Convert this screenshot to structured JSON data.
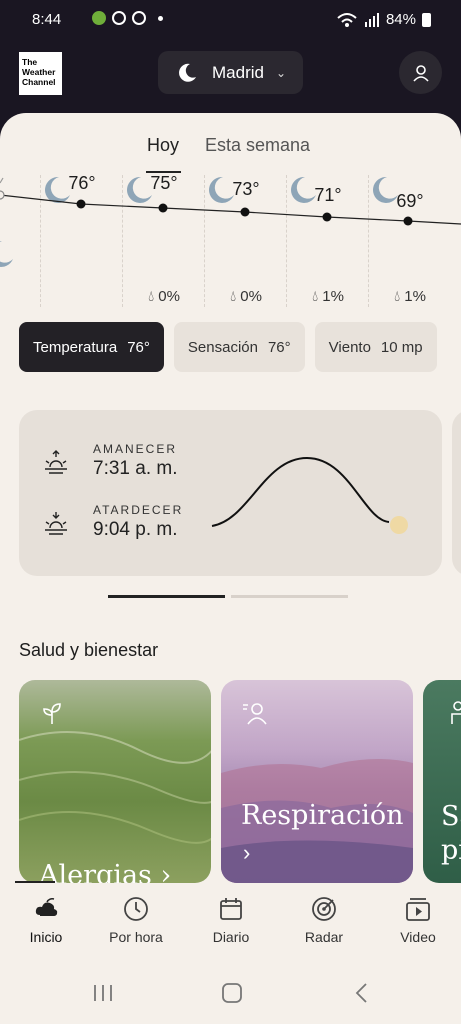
{
  "status_bar": {
    "time": "8:44",
    "battery": "84%"
  },
  "header": {
    "logo_lines": [
      "The",
      "Weather",
      "Channel"
    ],
    "city": "Madrid"
  },
  "tabs": [
    "Hoy",
    "Esta semana"
  ],
  "hourly": [
    {
      "temp": "76°",
      "precip": ""
    },
    {
      "temp": "75°",
      "precip": "0%"
    },
    {
      "temp": "73°",
      "precip": "0%"
    },
    {
      "temp": "71°",
      "precip": "1%"
    },
    {
      "temp": "69°",
      "precip": "1%"
    }
  ],
  "chips": [
    {
      "label": "Temperatura",
      "value": "76°"
    },
    {
      "label": "Sensación",
      "value": "76°"
    },
    {
      "label": "Viento",
      "value": "10 mp"
    }
  ],
  "sun": {
    "sunrise_label": "AMANECER",
    "sunrise_time": "7:31 a. m.",
    "sunset_label": "ATARDECER",
    "sunset_time": "9:04 p. m."
  },
  "health": {
    "title": "Salud y bienestar",
    "cards": [
      "Alergias ›",
      "Respiración",
      "Sa pi"
    ]
  },
  "nav": [
    "Inicio",
    "Por hora",
    "Diario",
    "Radar",
    "Video"
  ],
  "colors": {
    "dark": "#1a1622",
    "sheet": "#f5f0ea",
    "accent": "#232126",
    "sun": "#efd9a4"
  }
}
